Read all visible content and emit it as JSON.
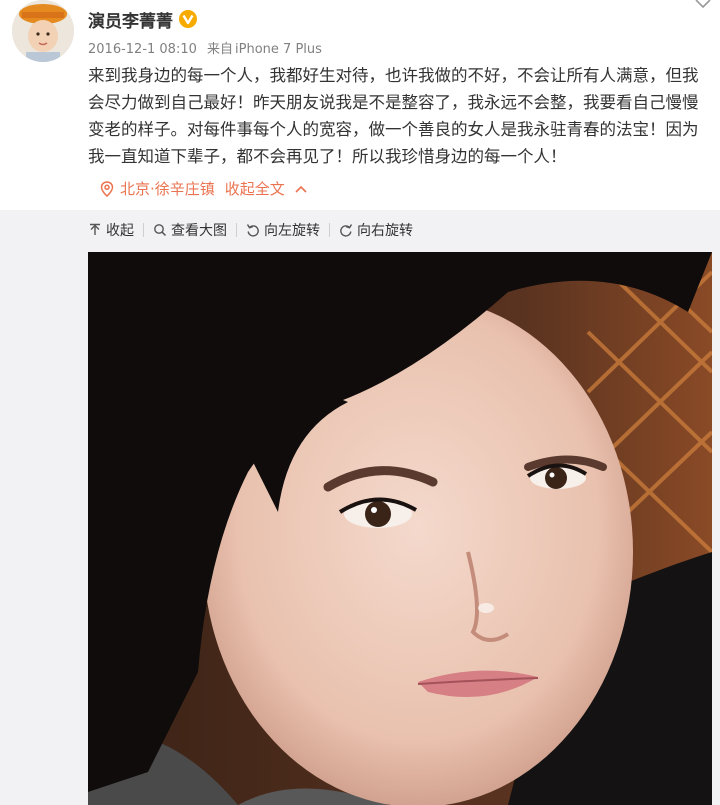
{
  "post": {
    "author": "演员李菁菁",
    "verified_icon": "v-badge-icon",
    "timestamp": "2016-12-1 08:10",
    "source_prefix": "来自",
    "source": "iPhone 7 Plus",
    "content": "来到我身边的每一个人，我都好生对待，也许我做的不好，不会让所有人满意，但我会尽力做到自己最好！昨天朋友说我是不是整容了，我永远不会整，我要看自己慢慢变老的样子。对每件事每个人的宽容，做一个善良的女人是我永驻青春的法宝！因为我一直知道下辈子，都不会再见了！所以我珍惜身边的每一个人！",
    "location": "北京·徐辛庄镇",
    "collapse_all": "收起全文"
  },
  "toolbar": {
    "collapse": "收起",
    "view_large": "查看大图",
    "rotate_left": "向左旋转",
    "rotate_right": "向右旋转"
  },
  "colors": {
    "accent": "#eb7350",
    "verified": "#f7ab00",
    "toolbar_bg": "#f2f2f5"
  }
}
